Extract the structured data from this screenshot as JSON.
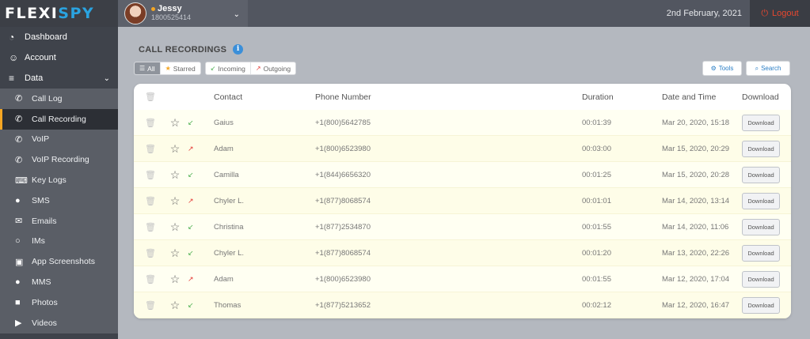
{
  "brand": {
    "part1": "FLEXI",
    "part2": "SPY"
  },
  "user": {
    "name": "Jessy",
    "phone": "1800525414"
  },
  "header": {
    "date": "2nd February, 2021",
    "logout_label": "Logout"
  },
  "sidebar": {
    "top": [
      {
        "label": "Dashboard",
        "icon": "tachometer-icon"
      },
      {
        "label": "Account",
        "icon": "user-icon"
      },
      {
        "label": "Data",
        "icon": "database-icon"
      }
    ],
    "sub": [
      {
        "label": "Call Log",
        "icon": "phone-icon"
      },
      {
        "label": "Call Recording",
        "icon": "phone-recording-icon"
      },
      {
        "label": "VoIP",
        "icon": "voip-icon"
      },
      {
        "label": "VoIP Recording",
        "icon": "voip-recording-icon"
      },
      {
        "label": "Key Logs",
        "icon": "keyboard-icon"
      },
      {
        "label": "SMS",
        "icon": "chat-icon"
      },
      {
        "label": "Emails",
        "icon": "envelope-icon"
      },
      {
        "label": "IMs",
        "icon": "im-icon"
      },
      {
        "label": "App Screenshots",
        "icon": "screenshot-icon"
      },
      {
        "label": "MMS",
        "icon": "mms-icon"
      },
      {
        "label": "Photos",
        "icon": "camera-icon"
      },
      {
        "label": "Videos",
        "icon": "video-icon"
      }
    ]
  },
  "page": {
    "title": "CALL RECORDINGS"
  },
  "filters": {
    "all": "All",
    "starred": "Starred",
    "incoming": "Incoming",
    "outgoing": "Outgoing"
  },
  "toolbar": {
    "tools": "Tools",
    "search": "Search"
  },
  "table": {
    "headers": {
      "contact": "Contact",
      "phone": "Phone Number",
      "duration": "Duration",
      "datetime": "Date and Time",
      "download": "Download"
    },
    "download_label": "Download",
    "rows": [
      {
        "direction": "incoming",
        "contact": "Gaius",
        "phone": "+1(800)5642785",
        "duration": "00:01:39",
        "datetime": "Mar 20, 2020, 15:18"
      },
      {
        "direction": "outgoing",
        "contact": "Adam",
        "phone": "+1(800)6523980",
        "duration": "00:03:00",
        "datetime": "Mar 15, 2020, 20:29"
      },
      {
        "direction": "incoming",
        "contact": "Camilla",
        "phone": "+1(844)6656320",
        "duration": "00:01:25",
        "datetime": "Mar 15, 2020, 20:28"
      },
      {
        "direction": "outgoing",
        "contact": "Chyler L.",
        "phone": "+1(877)8068574",
        "duration": "00:01:01",
        "datetime": "Mar 14, 2020, 13:14"
      },
      {
        "direction": "incoming",
        "contact": "Christina",
        "phone": "+1(877)2534870",
        "duration": "00:01:55",
        "datetime": "Mar 14, 2020, 11:06"
      },
      {
        "direction": "incoming",
        "contact": "Chyler L.",
        "phone": "+1(877)8068574",
        "duration": "00:01:20",
        "datetime": "Mar 13, 2020, 22:26"
      },
      {
        "direction": "outgoing",
        "contact": "Adam",
        "phone": "+1(800)6523980",
        "duration": "00:01:55",
        "datetime": "Mar 12, 2020, 17:04"
      },
      {
        "direction": "incoming",
        "contact": "Thomas",
        "phone": "+1(877)5213652",
        "duration": "00:02:12",
        "datetime": "Mar 12, 2020, 16:47"
      }
    ]
  },
  "colors": {
    "accent_orange": "#f5a623",
    "logout_red": "#e8472f",
    "brand_blue": "#2aa3e0",
    "incoming_green": "#4caf50",
    "outgoing_red": "#e53935"
  }
}
